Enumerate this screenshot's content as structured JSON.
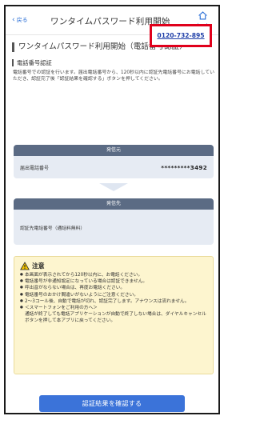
{
  "header": {
    "back_label": "戻る",
    "title": "ワンタイムパスワード利用開始",
    "home_label": "ホーム"
  },
  "section_title": "ワンタイムパスワード利用開始（電話番号認証）",
  "sub_title": "電話番号認証",
  "description": "電話番号での認証を行います。届出電話番号から、120秒以内に認証先電話番号にお電話していただき、認証完了後「認証結果を確認する」ボタンを押してください。",
  "caller_box": {
    "header": "発信元",
    "label": "届出電話番号",
    "value": "*********3492"
  },
  "dest_box": {
    "header": "発信先",
    "label": "認証先電話番号（通話料無料）",
    "phone": "0120-732-895"
  },
  "notice": {
    "title": "注意",
    "items": [
      "本画面が表示されてから120秒以内に、お電話ください。",
      "電話番号が非通知設定になっている場合は認証できません。",
      "呼出音がならない場合は、再度お電話ください。",
      "電話番号のおかけ間違いがないようにご注意ください。",
      "2〜3コール後、自動で電話が切れ、認証完了します。アナウンスは流れません。",
      "＜スマートフォンをご利用の方へ＞",
      "通話が終了しても電話アプリケーションが自動で終了しない場合は、ダイヤルキャンセルボタンを押して本アプリに戻ってください。"
    ]
  },
  "confirm_button": "認証結果を確認する",
  "colors": {
    "accent": "#3b73d9",
    "box_header": "#5b6b84",
    "box_bg": "#e6ebf3",
    "highlight": "#e0001b",
    "notice_bg": "#fdf5cf"
  }
}
